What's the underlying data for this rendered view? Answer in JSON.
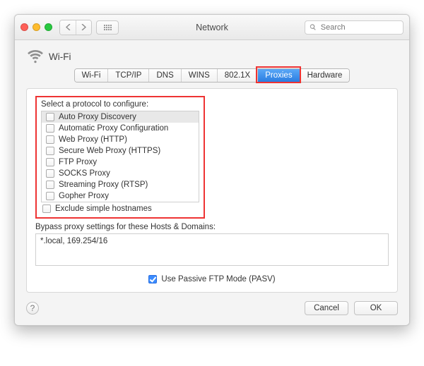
{
  "window": {
    "title": "Network",
    "search_placeholder": "Search"
  },
  "header": {
    "connection_name": "Wi-Fi"
  },
  "tabs": {
    "items": [
      "Wi-Fi",
      "TCP/IP",
      "DNS",
      "WINS",
      "802.1X",
      "Proxies",
      "Hardware"
    ],
    "active_index": 5
  },
  "proxies": {
    "section_label": "Select a protocol to configure:",
    "protocols": [
      {
        "label": "Auto Proxy Discovery",
        "checked": false,
        "selected": true
      },
      {
        "label": "Automatic Proxy Configuration",
        "checked": false,
        "selected": false
      },
      {
        "label": "Web Proxy (HTTP)",
        "checked": false,
        "selected": false
      },
      {
        "label": "Secure Web Proxy (HTTPS)",
        "checked": false,
        "selected": false
      },
      {
        "label": "FTP Proxy",
        "checked": false,
        "selected": false
      },
      {
        "label": "SOCKS Proxy",
        "checked": false,
        "selected": false
      },
      {
        "label": "Streaming Proxy (RTSP)",
        "checked": false,
        "selected": false
      },
      {
        "label": "Gopher Proxy",
        "checked": false,
        "selected": false
      }
    ],
    "exclude_simple_label": "Exclude simple hostnames",
    "exclude_simple_checked": false,
    "bypass_label": "Bypass proxy settings for these Hosts & Domains:",
    "bypass_value": "*.local, 169.254/16",
    "passive_ftp_label": "Use Passive FTP Mode (PASV)",
    "passive_ftp_checked": true
  },
  "footer": {
    "help_tooltip": "?",
    "cancel": "Cancel",
    "ok": "OK"
  },
  "annotation": {
    "highlight_color": "#e33"
  }
}
